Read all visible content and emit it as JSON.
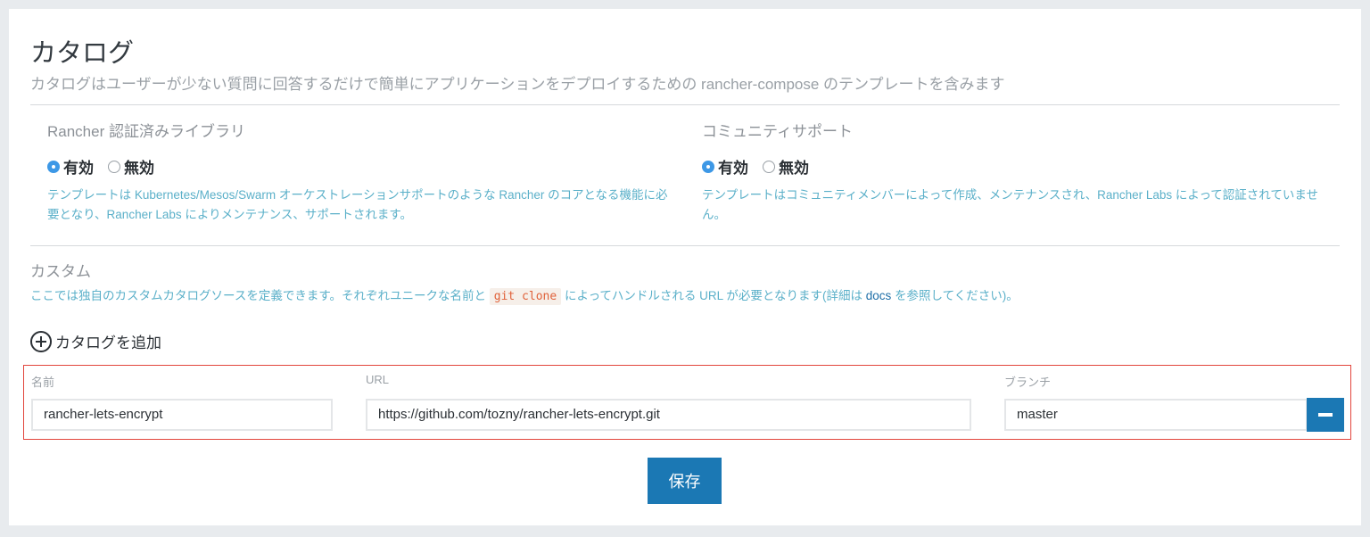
{
  "page": {
    "title": "カタログ",
    "subtitle": "カタログはユーザーが少ない質問に回答するだけで簡単にアプリケーションをデプロイするための rancher-compose のテンプレートを含みます"
  },
  "library": {
    "title": "Rancher 認証済みライブラリ",
    "enabled_label": "有効",
    "disabled_label": "無効",
    "selected": "有効",
    "help": "テンプレートは Kubernetes/Mesos/Swarm オーケストレーションサポートのような Rancher のコアとなる機能に必要となり、Rancher Labs によりメンテナンス、サポートされます。"
  },
  "community": {
    "title": "コミュニティサポート",
    "enabled_label": "有効",
    "disabled_label": "無効",
    "selected": "有効",
    "help": "テンプレートはコミュニティメンバーによって作成、メンテナンスされ、Rancher Labs によって認証されていません。"
  },
  "custom": {
    "title": "カスタム",
    "help_pre": "ここでは独自のカスタムカタログソースを定義できます。それぞれユニークな名前と",
    "help_code": "git clone",
    "help_mid": "によってハンドルされる URL が必要となります(詳細は",
    "help_link": "docs",
    "help_post": "を参照してください)。",
    "add_label": "カタログを追加"
  },
  "catalog": {
    "name_label": "名前",
    "url_label": "URL",
    "branch_label": "ブランチ",
    "name_value": "rancher-lets-encrypt",
    "url_value": "https://github.com/tozny/rancher-lets-encrypt.git",
    "branch_value": "master"
  },
  "actions": {
    "save_label": "保存"
  },
  "icons": {
    "add": "plus-circle-icon",
    "remove": "minus-icon"
  },
  "colors": {
    "primary": "#1b78b4",
    "radio_checked": "#3d98e6",
    "help_text": "#5bb0c9",
    "highlight_border": "#e2453c"
  }
}
